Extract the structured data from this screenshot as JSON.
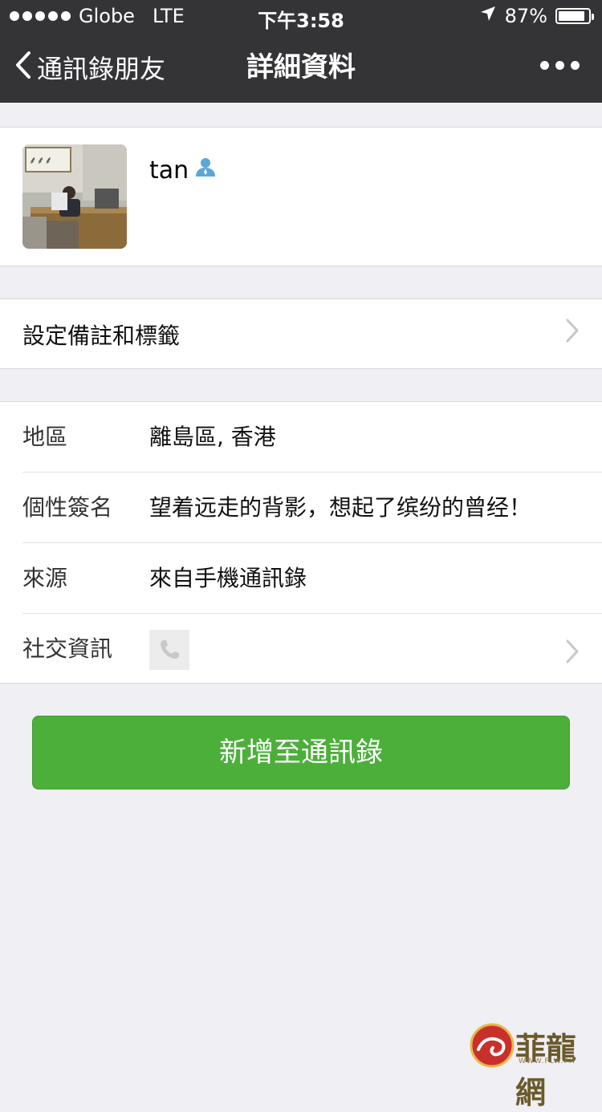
{
  "status_bar": {
    "carrier": "Globe",
    "network": "LTE",
    "time": "下午3:58",
    "battery": "87%"
  },
  "nav": {
    "back_label": "通訊錄朋友",
    "title": "詳細資料"
  },
  "profile": {
    "name": "tan"
  },
  "remark_row": {
    "label": "設定備註和標籤"
  },
  "info": {
    "region_label": "地區",
    "region_value": "離島區, 香港",
    "signature_label": "個性簽名",
    "signature_value": "望着远走的背影，想起了缤纷的曾经！",
    "source_label": "來源",
    "source_value": "來自手機通訊錄",
    "social_label": "社交資訊"
  },
  "actions": {
    "add_button": "新增至通訊錄"
  },
  "watermark": {
    "text": "菲龍網",
    "url": "WWW.FLW.PH"
  },
  "colors": {
    "nav_bg": "#343437",
    "page_bg": "#efeff4",
    "primary_button": "#4caf3a"
  }
}
